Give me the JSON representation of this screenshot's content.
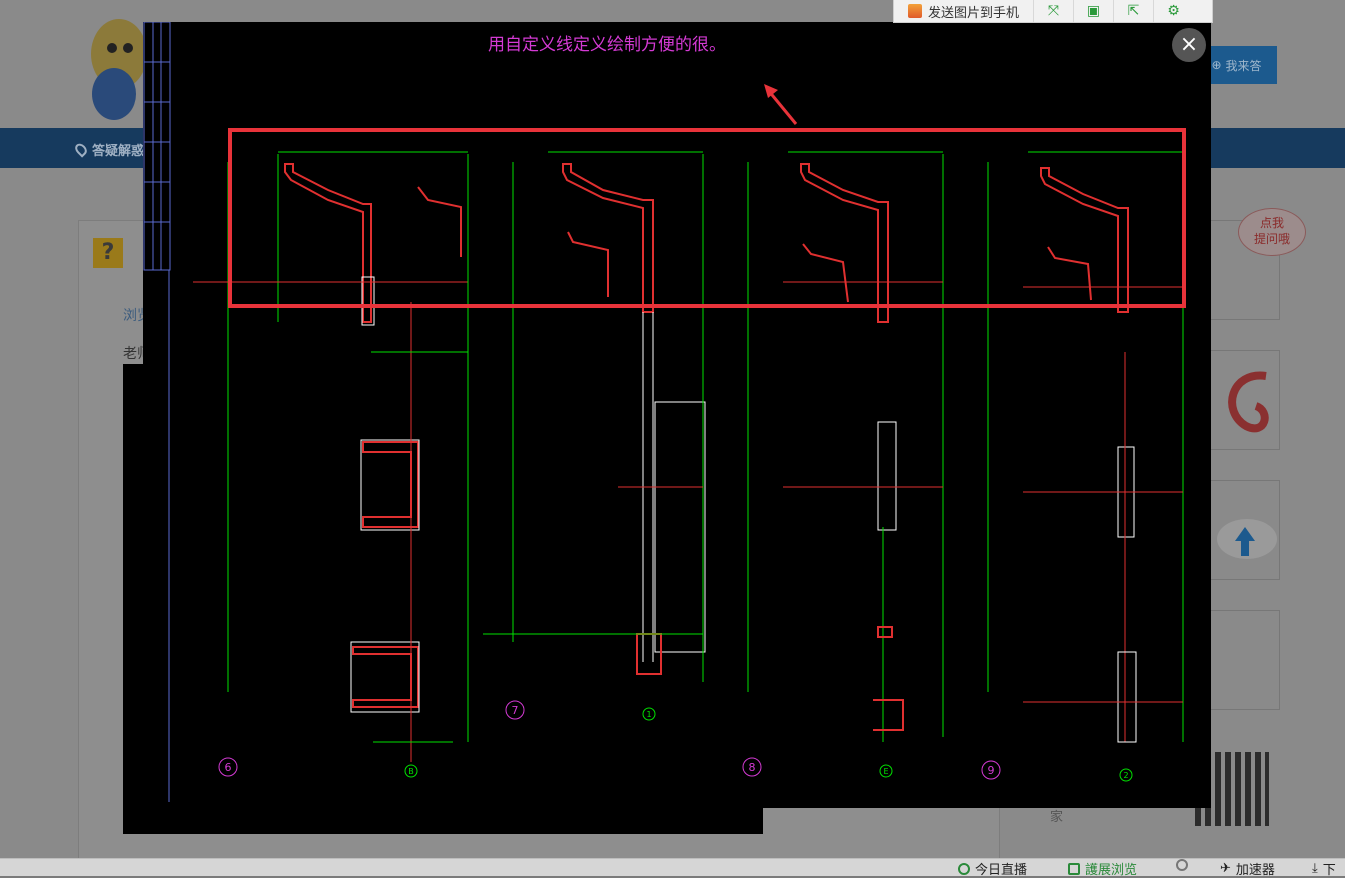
{
  "background_page": {
    "nav_item_label": "答疑解惑",
    "answer_button_label": "我来答",
    "side_link": "浏览",
    "side_text": "老师",
    "ask_bubble_label": "点我\n提问哦",
    "footer_text": "家"
  },
  "toolbar": {
    "send_to_phone_label": "发送图片到手机",
    "icons": [
      "fullscreen-icon",
      "save-icon",
      "share-icon",
      "settings-icon"
    ]
  },
  "viewer": {
    "caption": "用自定义线定义绘制方便的很。",
    "close_symbol": "×",
    "highlight_color": "#e8333a",
    "caption_color": "#d43ad4",
    "cad_line_colors": {
      "dimension": "#00e000",
      "section": "#e03030",
      "text": "#ffffff",
      "axis": "#b0b0ff"
    },
    "section_markers": [
      "6",
      "7",
      "8",
      "9"
    ],
    "axis_markers": [
      "B",
      "1",
      "E",
      "2"
    ]
  },
  "status_bar": {
    "items": [
      {
        "label": "今日直播",
        "icon": "play-icon"
      },
      {
        "label": "護展浏览",
        "icon": "phone-icon"
      },
      {
        "label": "",
        "icon": "speed-icon"
      },
      {
        "label": "加速器",
        "icon": "rocket-icon"
      },
      {
        "label": "下",
        "icon": "download-icon"
      }
    ]
  }
}
